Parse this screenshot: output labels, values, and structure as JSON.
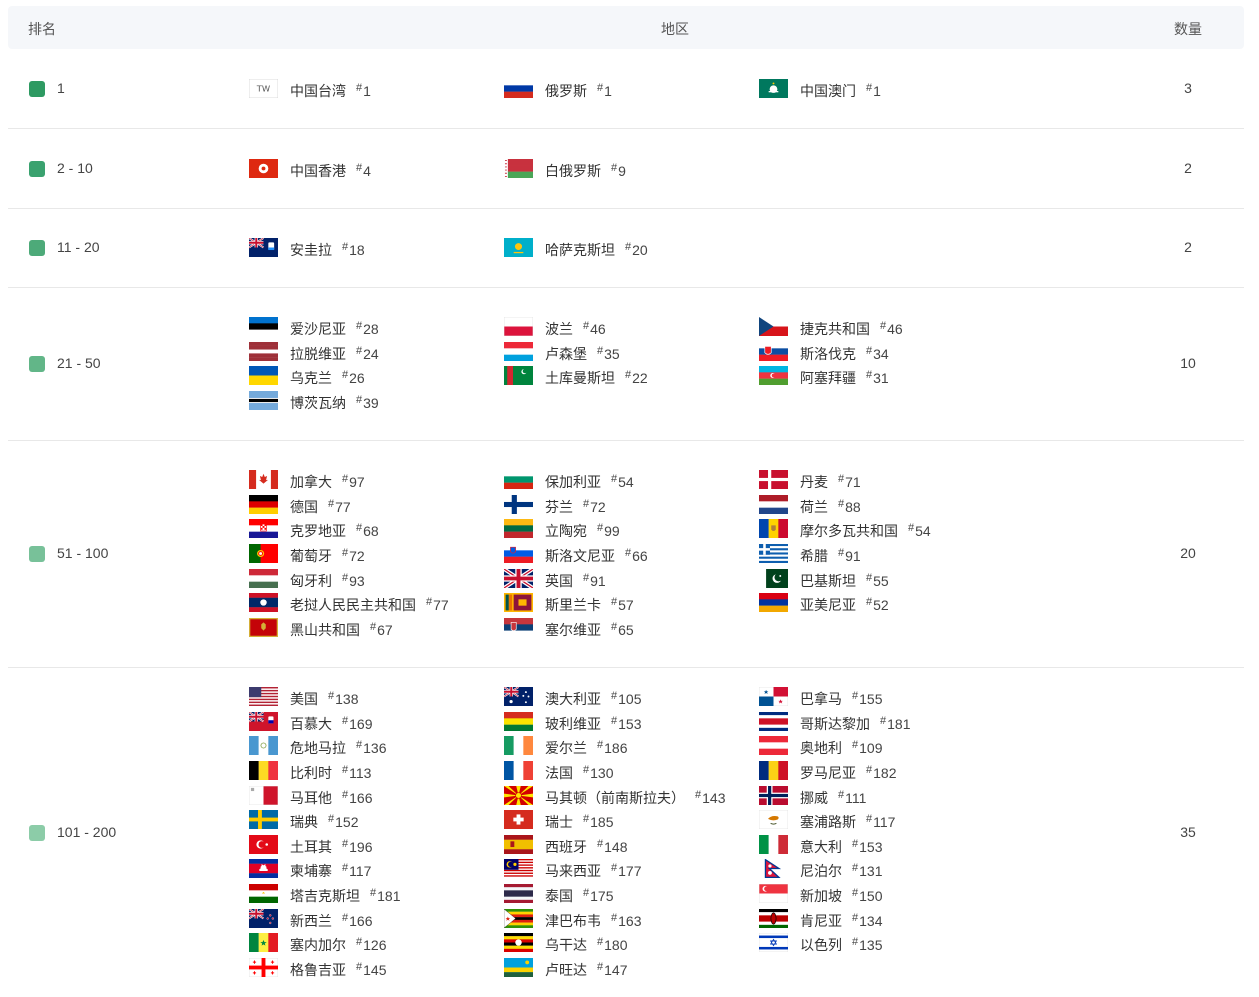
{
  "header": {
    "rank": "排名",
    "region": "地区",
    "count": "数量"
  },
  "rows": [
    {
      "label": "1",
      "count": "3",
      "color": "#2e9a62",
      "cols": [
        [
          {
            "name": "中国台湾",
            "rank": "1",
            "flag": "tw"
          }
        ],
        [
          {
            "name": "俄罗斯",
            "rank": "1",
            "flag": "ru"
          }
        ],
        [
          {
            "name": "中国澳门",
            "rank": "1",
            "flag": "mo"
          }
        ]
      ]
    },
    {
      "label": "2 - 10",
      "count": "2",
      "color": "#3aa26f",
      "cols": [
        [
          {
            "name": "中国香港",
            "rank": "4",
            "flag": "hk"
          }
        ],
        [
          {
            "name": "白俄罗斯",
            "rank": "9",
            "flag": "by"
          }
        ],
        []
      ]
    },
    {
      "label": "11 - 20",
      "count": "2",
      "color": "#4daa79",
      "cols": [
        [
          {
            "name": "安圭拉",
            "rank": "18",
            "flag": "ai"
          }
        ],
        [
          {
            "name": "哈萨克斯坦",
            "rank": "20",
            "flag": "kz"
          }
        ],
        []
      ]
    },
    {
      "label": "21 - 50",
      "count": "10",
      "color": "#62b688",
      "cols": [
        [
          {
            "name": "爱沙尼亚",
            "rank": "28",
            "flag": "ee"
          },
          {
            "name": "拉脱维亚",
            "rank": "24",
            "flag": "lv"
          },
          {
            "name": "乌克兰",
            "rank": "26",
            "flag": "ua"
          },
          {
            "name": "博茨瓦纳",
            "rank": "39",
            "flag": "bw"
          }
        ],
        [
          {
            "name": "波兰",
            "rank": "46",
            "flag": "pl"
          },
          {
            "name": "卢森堡",
            "rank": "35",
            "flag": "lu"
          },
          {
            "name": "土库曼斯坦",
            "rank": "22",
            "flag": "tm"
          }
        ],
        [
          {
            "name": "捷克共和国",
            "rank": "46",
            "flag": "cz"
          },
          {
            "name": "斯洛伐克",
            "rank": "34",
            "flag": "sk"
          },
          {
            "name": "阿塞拜疆",
            "rank": "31",
            "flag": "az"
          }
        ]
      ]
    },
    {
      "label": "51 - 100",
      "count": "20",
      "color": "#78c199",
      "cols": [
        [
          {
            "name": "加拿大",
            "rank": "97",
            "flag": "ca"
          },
          {
            "name": "德国",
            "rank": "77",
            "flag": "de"
          },
          {
            "name": "克罗地亚",
            "rank": "68",
            "flag": "hr"
          },
          {
            "name": "葡萄牙",
            "rank": "72",
            "flag": "pt"
          },
          {
            "name": "匈牙利",
            "rank": "93",
            "flag": "hu"
          },
          {
            "name": "老挝人民民主共和国",
            "rank": "77",
            "flag": "la"
          },
          {
            "name": "黑山共和国",
            "rank": "67",
            "flag": "me"
          }
        ],
        [
          {
            "name": "保加利亚",
            "rank": "54",
            "flag": "bg"
          },
          {
            "name": "芬兰",
            "rank": "72",
            "flag": "fi"
          },
          {
            "name": "立陶宛",
            "rank": "99",
            "flag": "lt"
          },
          {
            "name": "斯洛文尼亚",
            "rank": "66",
            "flag": "si"
          },
          {
            "name": "英国",
            "rank": "91",
            "flag": "gb"
          },
          {
            "name": "斯里兰卡",
            "rank": "57",
            "flag": "lk"
          },
          {
            "name": "塞尔维亚",
            "rank": "65",
            "flag": "rs"
          }
        ],
        [
          {
            "name": "丹麦",
            "rank": "71",
            "flag": "dk"
          },
          {
            "name": "荷兰",
            "rank": "88",
            "flag": "nl"
          },
          {
            "name": "摩尔多瓦共和国",
            "rank": "54",
            "flag": "md"
          },
          {
            "name": "希腊",
            "rank": "91",
            "flag": "gr"
          },
          {
            "name": "巴基斯坦",
            "rank": "55",
            "flag": "pk"
          },
          {
            "name": "亚美尼亚",
            "rank": "52",
            "flag": "am"
          }
        ]
      ]
    },
    {
      "label": "101 - 200",
      "count": "35",
      "color": "#8ccca8",
      "cols": [
        [
          {
            "name": "美国",
            "rank": "138",
            "flag": "us"
          },
          {
            "name": "百慕大",
            "rank": "169",
            "flag": "bm"
          },
          {
            "name": "危地马拉",
            "rank": "136",
            "flag": "gt"
          },
          {
            "name": "比利时",
            "rank": "113",
            "flag": "be"
          },
          {
            "name": "马耳他",
            "rank": "166",
            "flag": "mt"
          },
          {
            "name": "瑞典",
            "rank": "152",
            "flag": "se"
          },
          {
            "name": "土耳其",
            "rank": "196",
            "flag": "tr"
          },
          {
            "name": "柬埔寨",
            "rank": "117",
            "flag": "kh"
          },
          {
            "name": "塔吉克斯坦",
            "rank": "181",
            "flag": "tj"
          },
          {
            "name": "新西兰",
            "rank": "166",
            "flag": "nz"
          },
          {
            "name": "塞内加尔",
            "rank": "126",
            "flag": "sn"
          },
          {
            "name": "格鲁吉亚",
            "rank": "145",
            "flag": "ge"
          }
        ],
        [
          {
            "name": "澳大利亚",
            "rank": "105",
            "flag": "au"
          },
          {
            "name": "玻利维亚",
            "rank": "153",
            "flag": "bo"
          },
          {
            "name": "爱尔兰",
            "rank": "186",
            "flag": "ie"
          },
          {
            "name": "法国",
            "rank": "130",
            "flag": "fr"
          },
          {
            "name": "马其顿（前南斯拉夫）",
            "rank": "143",
            "flag": "mk"
          },
          {
            "name": "瑞士",
            "rank": "185",
            "flag": "ch"
          },
          {
            "name": "西班牙",
            "rank": "148",
            "flag": "es"
          },
          {
            "name": "马来西亚",
            "rank": "177",
            "flag": "my"
          },
          {
            "name": "泰国",
            "rank": "175",
            "flag": "th"
          },
          {
            "name": "津巴布韦",
            "rank": "163",
            "flag": "zw"
          },
          {
            "name": "乌干达",
            "rank": "180",
            "flag": "ug"
          },
          {
            "name": "卢旺达",
            "rank": "147",
            "flag": "rw"
          }
        ],
        [
          {
            "name": "巴拿马",
            "rank": "155",
            "flag": "pa"
          },
          {
            "name": "哥斯达黎加",
            "rank": "181",
            "flag": "cr"
          },
          {
            "name": "奥地利",
            "rank": "109",
            "flag": "at"
          },
          {
            "name": "罗马尼亚",
            "rank": "182",
            "flag": "ro"
          },
          {
            "name": "挪威",
            "rank": "111",
            "flag": "no"
          },
          {
            "name": "塞浦路斯",
            "rank": "117",
            "flag": "cy"
          },
          {
            "name": "意大利",
            "rank": "153",
            "flag": "it"
          },
          {
            "name": "尼泊尔",
            "rank": "131",
            "flag": "np"
          },
          {
            "name": "新加坡",
            "rank": "150",
            "flag": "sg"
          },
          {
            "name": "肯尼亚",
            "rank": "134",
            "flag": "ke"
          },
          {
            "name": "以色列",
            "rank": "135",
            "flag": "il"
          }
        ]
      ]
    }
  ]
}
